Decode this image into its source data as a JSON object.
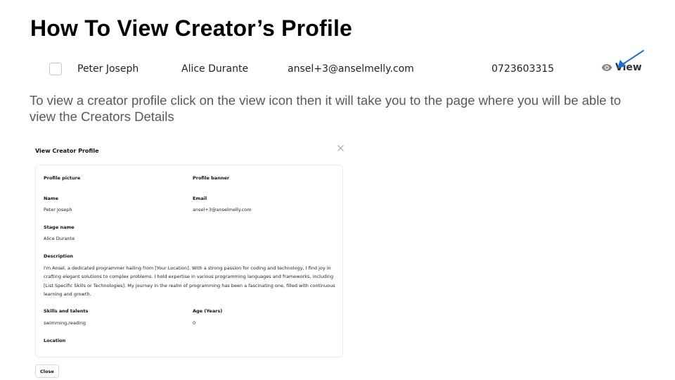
{
  "slide": {
    "title": "How To View Creator’s Profile",
    "instruction": "To view a creator profile click on the view icon then it will take you to the page where you will be able to view the Creators Details"
  },
  "table_row": {
    "name": "Peter Joseph",
    "stage_name": "Alice Durante",
    "email": "ansel+3@anselmelly.com",
    "phone": "0723603315",
    "view_label": "View",
    "view_icon": "eye-icon"
  },
  "modal": {
    "title": "View Creator Profile",
    "close_icon": "close-icon",
    "fields": {
      "profile_picture_label": "Profile picture",
      "profile_banner_label": "Profile banner",
      "name_label": "Name",
      "name_value": "Peter Joseph",
      "email_label": "Email",
      "email_value": "ansel+3@anselmelly.com",
      "stage_name_label": "Stage name",
      "stage_name_value": "Alice Durante",
      "description_label": "Description",
      "description_value": "I'm Ansel, a dedicated programmer hailing from [Your Location]. With a strong passion for coding and technology, I find joy in crafting elegant solutions to complex problems. I hold expertise in various programming languages and frameworks, including [List Specific Skills or Technologies]. My journey in the realm of programming has been a fascinating one, filled with continuous learning and growth.",
      "skills_label": "Skills and talents",
      "skills_value": "swimming,reading",
      "age_label": "Age (Years)",
      "age_value": "0",
      "location_label": "Location"
    },
    "close_button": "Close"
  },
  "colors": {
    "annotation_arrow": "#1f6fd1",
    "instruction_text": "#595959"
  }
}
